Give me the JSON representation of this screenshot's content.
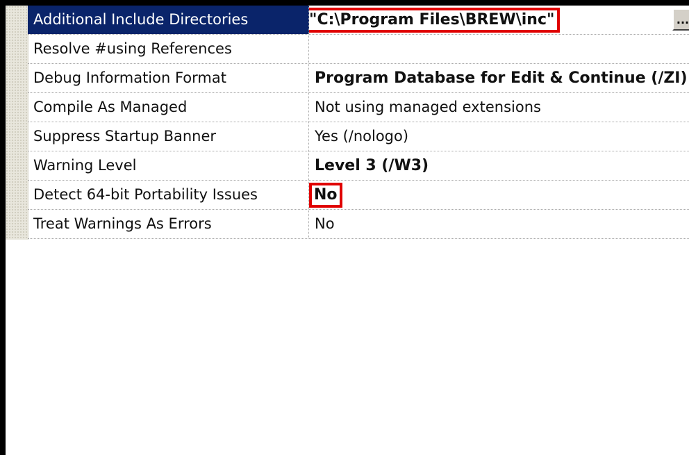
{
  "properties": [
    {
      "name": "Additional Include Directories",
      "value": "\"C:\\Program Files\\BREW\\inc\"",
      "bold": true,
      "selected": true,
      "highlighted": true
    },
    {
      "name": "Resolve #using References",
      "value": "",
      "bold": false
    },
    {
      "name": "Debug Information Format",
      "value": "Program Database for Edit & Continue (/ZI)",
      "bold": true
    },
    {
      "name": "Compile As Managed",
      "value": "Not using managed extensions",
      "bold": false
    },
    {
      "name": "Suppress Startup Banner",
      "value": "Yes (/nologo)",
      "bold": false
    },
    {
      "name": "Warning Level",
      "value": "Level 3 (/W3)",
      "bold": true
    },
    {
      "name": "Detect 64-bit Portability Issues",
      "value": "No",
      "bold": true,
      "highlighted": true
    },
    {
      "name": "Treat Warnings As Errors",
      "value": "No",
      "bold": false
    }
  ],
  "browse_button_label": "...",
  "colors": {
    "selection": "#0a246a",
    "highlight_border": "#e00000",
    "gutter": "#e8e6dc"
  }
}
